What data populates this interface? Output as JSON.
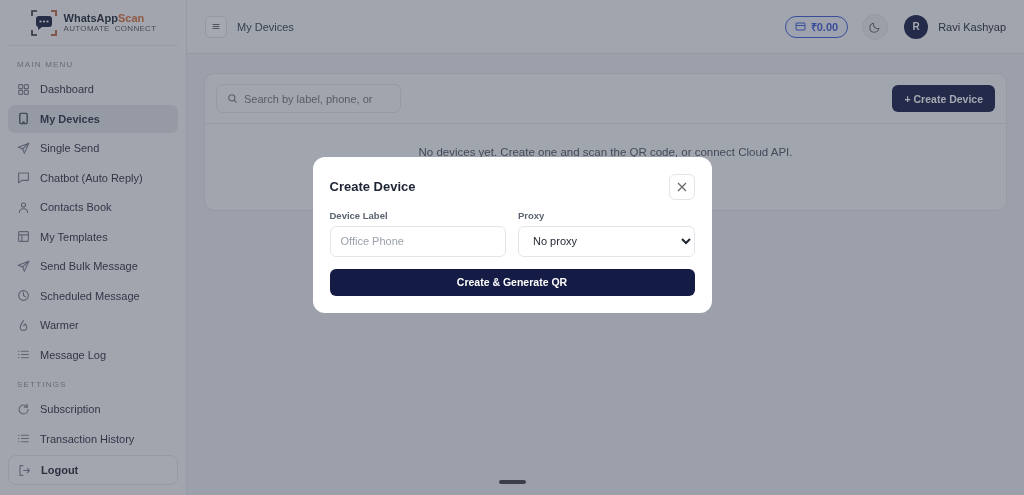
{
  "sidebar": {
    "logo": {
      "name": "WhatsApp",
      "accent": "Scan",
      "tagline": [
        "AUTOMATE",
        "CONNECT"
      ]
    },
    "sections": [
      {
        "title": "MAIN MENU",
        "items": [
          {
            "label": "Dashboard",
            "selected": false
          },
          {
            "label": "My Devices",
            "selected": true
          },
          {
            "label": "Single Send",
            "selected": false
          },
          {
            "label": "Chatbot (Auto Reply)",
            "selected": false
          },
          {
            "label": "Contacts Book",
            "selected": false
          },
          {
            "label": "My Templates",
            "selected": false
          },
          {
            "label": "Send Bulk Message",
            "selected": false
          },
          {
            "label": "Scheduled Message",
            "selected": false
          },
          {
            "label": "Warmer",
            "selected": false
          },
          {
            "label": "Message Log",
            "selected": false
          }
        ]
      },
      {
        "title": "SETTINGS",
        "items": [
          {
            "label": "Subscription",
            "selected": false
          },
          {
            "label": "Transaction History",
            "selected": false
          }
        ]
      }
    ],
    "logout": "Logout"
  },
  "header": {
    "title": "My Devices",
    "balance": "₹0.00",
    "user": {
      "initial": "R",
      "name": "Ravi Kashyap"
    }
  },
  "devices": {
    "search": {
      "placeholder": "Search by label, phone, or"
    },
    "create_button": "+ Create Device",
    "empty_message": "No devices yet. Create one and scan the QR code, or connect Cloud API."
  },
  "modal": {
    "title": "Create Device",
    "fields": [
      {
        "kind": "text",
        "label": "Device Label",
        "placeholder": "Office Phone"
      },
      {
        "kind": "select",
        "label": "Proxy",
        "value": "No proxy"
      }
    ],
    "submit": "Create & Generate QR"
  }
}
